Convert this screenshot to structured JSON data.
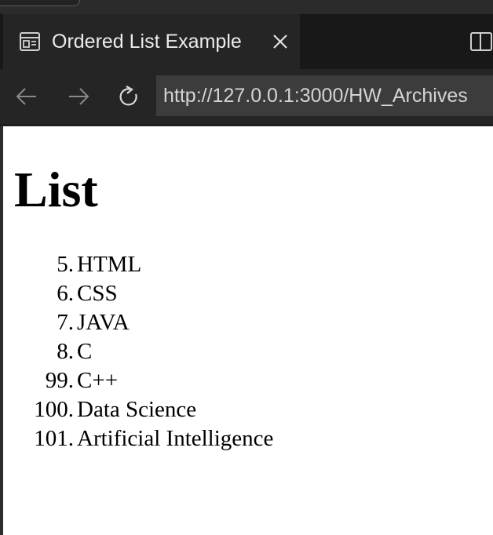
{
  "tab": {
    "title": "Ordered List Example",
    "icon": "page-preview-icon",
    "close_icon": "close-icon"
  },
  "toolbar": {
    "back_icon": "arrow-left-icon",
    "forward_icon": "arrow-right-icon",
    "reload_icon": "reload-icon",
    "split_icon": "split-editor-icon"
  },
  "address_bar": {
    "url": "http://127.0.0.1:3000/HW_Archives"
  },
  "page": {
    "heading": "List",
    "items": [
      {
        "number": "5.",
        "text": "HTML"
      },
      {
        "number": "6.",
        "text": "CSS"
      },
      {
        "number": "7.",
        "text": "JAVA"
      },
      {
        "number": "8.",
        "text": "C"
      },
      {
        "number": "99.",
        "text": "C++"
      },
      {
        "number": "100.",
        "text": "Data Science"
      },
      {
        "number": "101.",
        "text": "Artificial Intelligence"
      }
    ]
  },
  "colors": {
    "tab_bg": "#252526",
    "tabbar_bg": "#181818",
    "url_bg": "#3c3c3c",
    "text_light": "#ececec"
  }
}
